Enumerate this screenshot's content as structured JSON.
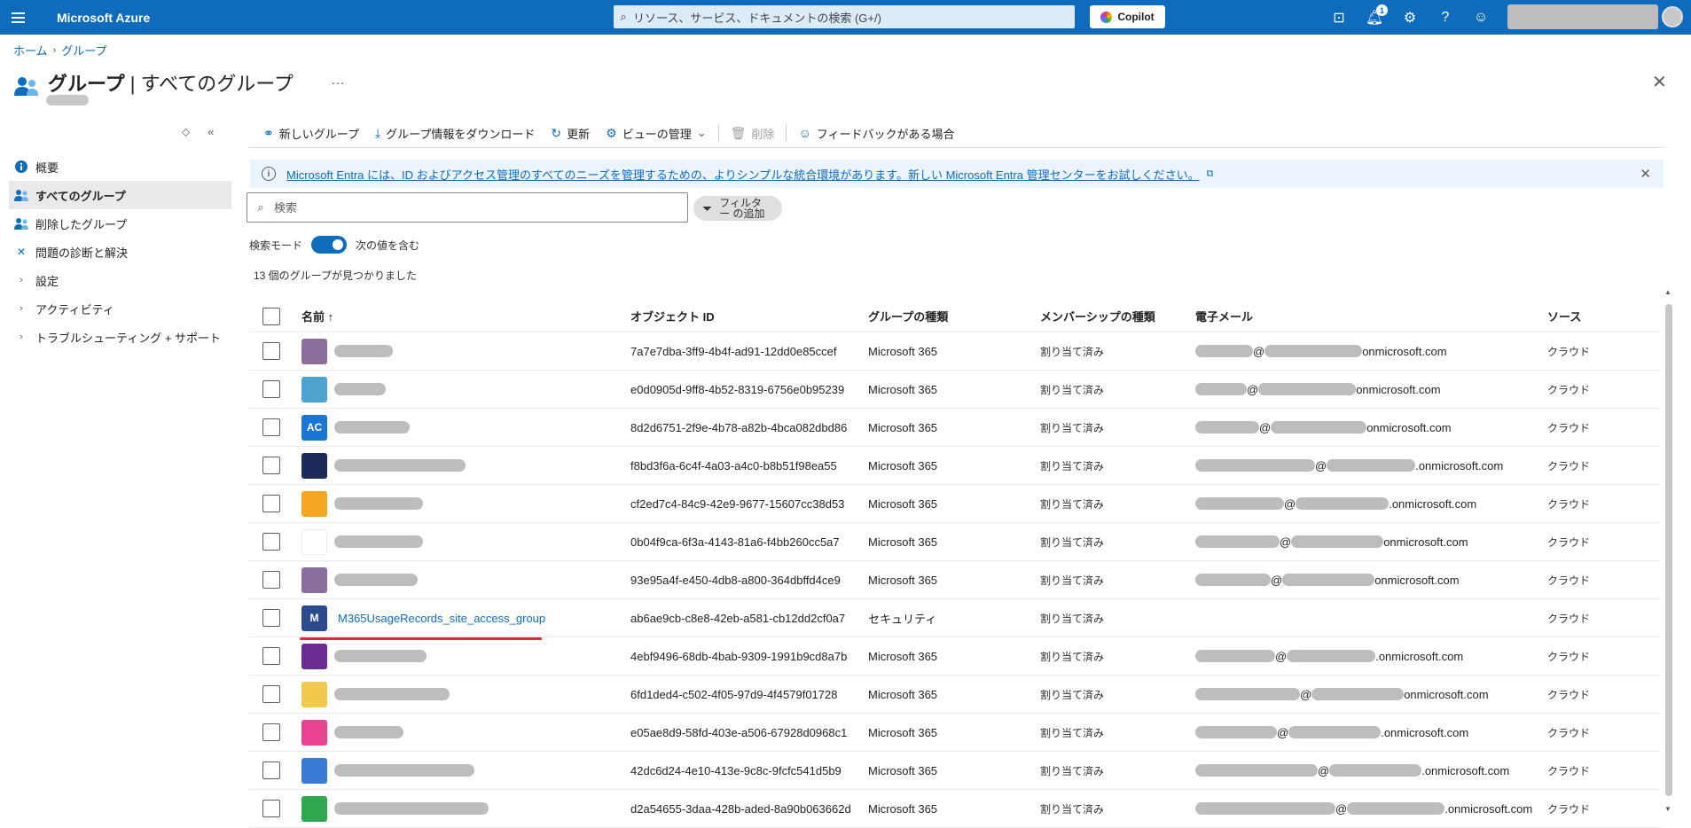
{
  "topbar": {
    "brand": "Microsoft Azure",
    "search_placeholder": "リソース、サービス、ドキュメントの検索 (G+/)",
    "copilot_label": "Copilot",
    "notification_count": "1"
  },
  "breadcrumb": {
    "home": "ホーム",
    "groups": "グループ"
  },
  "page": {
    "title_main": "グループ",
    "title_sep": " | ",
    "title_sub": "すべてのグループ",
    "more": "…"
  },
  "nav": {
    "items": [
      {
        "label": "概要",
        "icon": "info-icon"
      },
      {
        "label": "すべてのグループ",
        "icon": "people-icon"
      },
      {
        "label": "削除したグループ",
        "icon": "people-icon"
      },
      {
        "label": "問題の診断と解決",
        "icon": "wrench-icon"
      },
      {
        "label": "設定",
        "icon": "chevron-right-icon"
      },
      {
        "label": "アクティビティ",
        "icon": "chevron-right-icon"
      },
      {
        "label": "トラブルシューティング + サポート",
        "icon": "chevron-right-icon"
      }
    ]
  },
  "toolbar": {
    "new_group": "新しいグループ",
    "download": "グループ情報をダウンロード",
    "refresh": "更新",
    "manage_view": "ビューの管理",
    "delete": "削除",
    "feedback": "フィードバックがある場合"
  },
  "banner": {
    "text": "Microsoft Entra には、ID およびアクセス管理のすべてのニーズを管理するための、よりシンプルな統合環境があります。新しい Microsoft Entra 管理センターをお試しください。"
  },
  "search": {
    "placeholder": "検索"
  },
  "filter": {
    "label": "フィルター の追加"
  },
  "search_mode": {
    "label": "検索モード",
    "value": "次の値を含む"
  },
  "result_count": "13 個のグループが見つかりました",
  "table": {
    "headers": {
      "name": "名前 ↑",
      "object_id": "オブジェクト ID",
      "group_type": "グループの種類",
      "membership": "メンバーシップの種類",
      "email": "電子メール",
      "source": "ソース"
    },
    "rows": [
      {
        "name": "",
        "icon_text": "",
        "icon_color": "#8a6f9e",
        "object_id": "7a7e7dba-3ff9-4b4f-ad91-12dd0e85ccef",
        "group_type": "Microsoft 365",
        "membership": "割り当て済み",
        "email_suffix": "onmicrosoft.com",
        "source": "クラウド"
      },
      {
        "name": "",
        "icon_text": "",
        "icon_color": "#4fa3d1",
        "object_id": "e0d0905d-9ff8-4b52-8319-6756e0b95239",
        "group_type": "Microsoft 365",
        "membership": "割り当て済み",
        "email_suffix": "onmicrosoft.com",
        "source": "クラウド"
      },
      {
        "name": "",
        "icon_text": "AC",
        "icon_color": "#1976d2",
        "object_id": "8d2d6751-2f9e-4b78-a82b-4bca082dbd86",
        "group_type": "Microsoft 365",
        "membership": "割り当て済み",
        "email_suffix": "onmicrosoft.com",
        "source": "クラウド"
      },
      {
        "name": "",
        "icon_text": "",
        "icon_color": "#1c2b5a",
        "object_id": "f8bd3f6a-6c4f-4a03-a4c0-b8b51f98ea55",
        "group_type": "Microsoft 365",
        "membership": "割り当て済み",
        "email_suffix": ".onmicrosoft.com",
        "source": "クラウド"
      },
      {
        "name": "",
        "icon_text": "",
        "icon_color": "#f5a623",
        "object_id": "cf2ed7c4-84c9-42e9-9677-15607cc38d53",
        "group_type": "Microsoft 365",
        "membership": "割り当て済み",
        "email_suffix": ".onmicrosoft.com",
        "source": "クラウド"
      },
      {
        "name": "",
        "icon_text": "",
        "icon_color": "#ffffff",
        "object_id": "0b04f9ca-6f3a-4143-81a6-f4bb260cc5a7",
        "group_type": "Microsoft 365",
        "membership": "割り当て済み",
        "email_suffix": "onmicrosoft.com",
        "source": "クラウド"
      },
      {
        "name": "",
        "icon_text": "",
        "icon_color": "#8a6f9e",
        "object_id": "93e95a4f-e450-4db8-a800-364dbffd4ce9",
        "group_type": "Microsoft 365",
        "membership": "割り当て済み",
        "email_suffix": "onmicrosoft.com",
        "source": "クラウド"
      },
      {
        "name": "M365UsageRecords_site_access_group",
        "icon_text": "M",
        "icon_color": "#2b4b8c",
        "object_id": "ab6ae9cb-c8e8-42eb-a581-cb12dd2cf0a7",
        "group_type": "セキュリティ",
        "membership": "割り当て済み",
        "email_suffix": "",
        "source": "クラウド"
      },
      {
        "name": "",
        "icon_text": "",
        "icon_color": "#6a2c91",
        "object_id": "4ebf9496-68db-4bab-9309-1991b9cd8a7b",
        "group_type": "Microsoft 365",
        "membership": "割り当て済み",
        "email_suffix": ".onmicrosoft.com",
        "source": "クラウド"
      },
      {
        "name": "",
        "icon_text": "",
        "icon_color": "#f2c94c",
        "object_id": "6fd1ded4-c502-4f05-97d9-4f4579f01728",
        "group_type": "Microsoft 365",
        "membership": "割り当て済み",
        "email_suffix": "onmicrosoft.com",
        "source": "クラウド"
      },
      {
        "name": "",
        "icon_text": "",
        "icon_color": "#e84393",
        "object_id": "e05ae8d9-58fd-403e-a506-67928d0968c1",
        "group_type": "Microsoft 365",
        "membership": "割り当て済み",
        "email_suffix": ".onmicrosoft.com",
        "source": "クラウド"
      },
      {
        "name": "",
        "icon_text": "",
        "icon_color": "#3a7bd5",
        "object_id": "42dc6d24-4e10-413e-9c8c-9fcfc541d5b9",
        "group_type": "Microsoft 365",
        "membership": "割り当て済み",
        "email_suffix": ".onmicrosoft.com",
        "source": "クラウド"
      },
      {
        "name": "",
        "icon_text": "",
        "icon_color": "#2fa84f",
        "object_id": "d2a54655-3daa-428b-aded-8a90b063662d",
        "group_type": "Microsoft 365",
        "membership": "割り当て済み",
        "email_suffix": ".onmicrosoft.com",
        "source": "クラウド"
      }
    ]
  }
}
